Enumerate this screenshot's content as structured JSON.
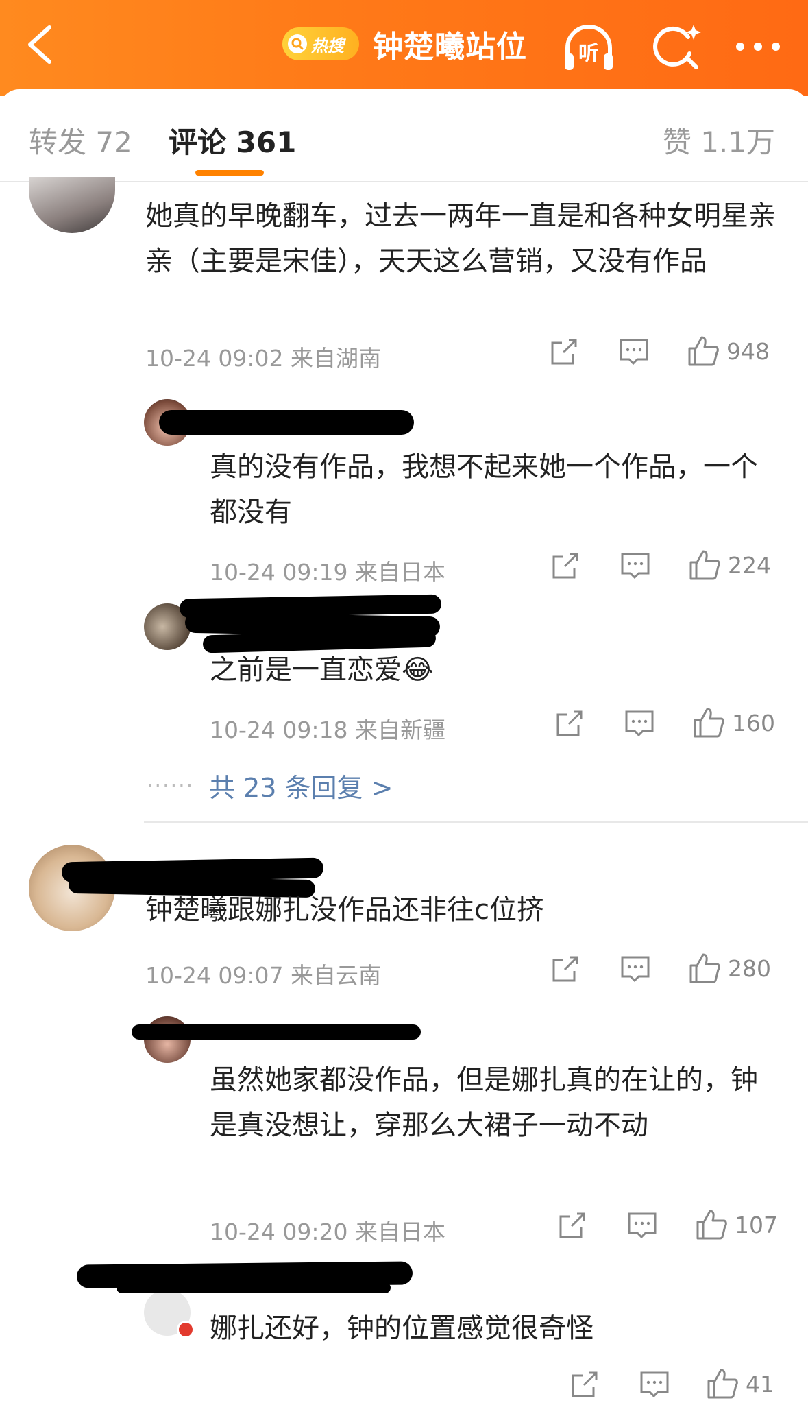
{
  "header": {
    "hot_label": "热搜",
    "title": "钟楚曦站位",
    "listen_label": "听",
    "icons": [
      "back-arrow-icon",
      "search-sparkle-icon",
      "more-icon"
    ],
    "accent": "#ff7a18"
  },
  "tabs": {
    "repost": "转发 72",
    "comments": "评论 361",
    "likes": "赞 1.1万"
  },
  "comments": [
    {
      "text": "她真的早晚翻车，过去一两年一直是和各种女明星亲亲（主要是宋佳），天天这么营销，又没有作品",
      "time": "10-24 09:02",
      "location": "来自湖南",
      "likes": "948",
      "replies": [
        {
          "text": "真的没有作品，我想不起来她一个作品，一个都没有",
          "time": "10-24 09:19",
          "location": "来自日本",
          "likes": "224"
        },
        {
          "text": "之前是一直恋爱",
          "emoji": "😂",
          "time": "10-24 09:18",
          "location": "来自新疆",
          "likes": "160"
        }
      ],
      "more_replies": "共 23 条回复 >"
    },
    {
      "text": "钟楚曦跟娜扎没作品还非往c位挤",
      "time": "10-24 09:07",
      "location": "来自云南",
      "likes": "280",
      "replies": [
        {
          "text": "虽然她家都没作品，但是娜扎真的在让的，钟是真没想让，穿那么大裙子一动不动",
          "time": "10-24 09:20",
          "location": "来自日本",
          "likes": "107"
        },
        {
          "text": "娜扎还好，钟的位置感觉很奇怪",
          "likes": "41"
        }
      ]
    }
  ]
}
